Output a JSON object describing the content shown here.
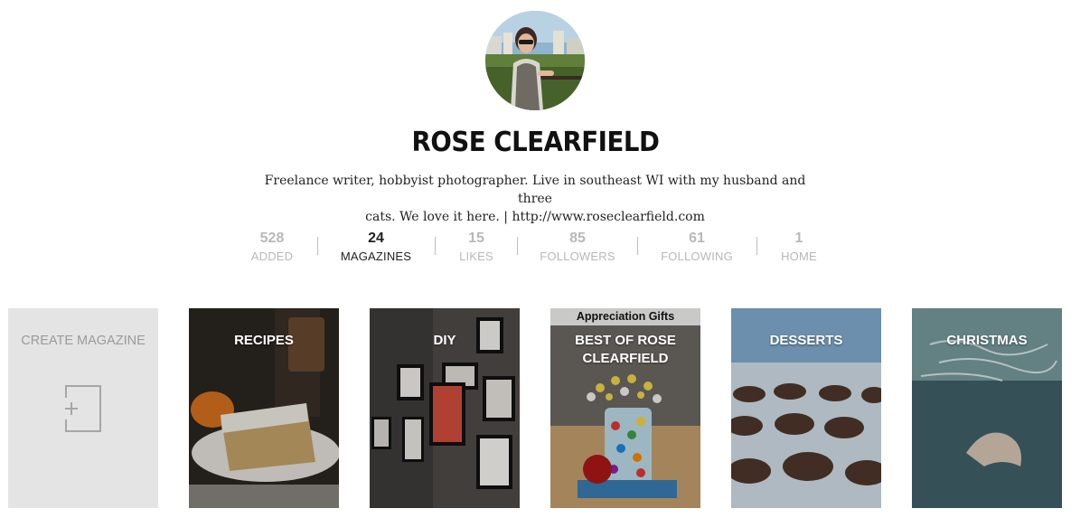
{
  "profile": {
    "name": "ROSE CLEARFIELD",
    "bio_line1": "Freelance writer, hobbyist photographer. Live in southeast WI with my husband and three",
    "bio_line2": "cats. We love it here. | http://www.roseclearfield.com"
  },
  "stats": [
    {
      "value": "528",
      "label": "ADDED"
    },
    {
      "value": "24",
      "label": "MAGAZINES"
    },
    {
      "value": "15",
      "label": "LIKES"
    },
    {
      "value": "85",
      "label": "FOLLOWERS"
    },
    {
      "value": "61",
      "label": "FOLLOWING"
    },
    {
      "value": "1",
      "label": "HOME"
    }
  ],
  "magazines": {
    "create_label": "CREATE MAGAZINE",
    "tiles": [
      {
        "title": "RECIPES"
      },
      {
        "title": "DIY"
      },
      {
        "title": "BEST OF ROSE CLEARFIELD",
        "banner": "Appreciation Gifts"
      },
      {
        "title": "DESSERTS"
      },
      {
        "title": "CHRISTMAS"
      }
    ]
  }
}
